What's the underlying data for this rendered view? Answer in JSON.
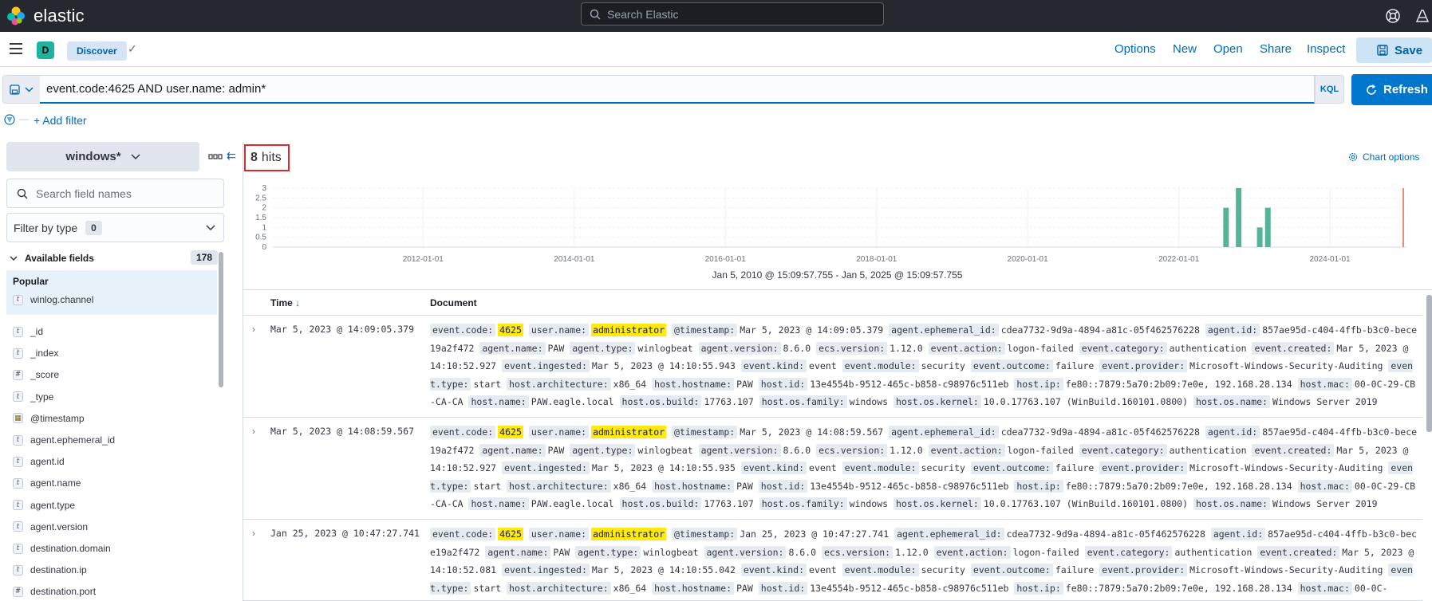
{
  "header": {
    "brand": "elastic",
    "search_placeholder": "Search Elastic"
  },
  "appbar": {
    "space_initial": "D",
    "breadcrumb": "Discover",
    "menu": [
      "Options",
      "New",
      "Open",
      "Share",
      "Inspect"
    ],
    "save_label": "Save"
  },
  "query": {
    "value": "event.code:4625 AND user.name: admin*",
    "language": "KQL",
    "refresh_label": "Refresh",
    "add_filter_label": "+ Add filter"
  },
  "sidebar": {
    "index_pattern": "windows*",
    "search_placeholder": "Search field names",
    "filter_by_type_label": "Filter by type",
    "filter_by_type_count": "0",
    "available_fields_label": "Available fields",
    "available_fields_count": "178",
    "popular_label": "Popular",
    "popular_fields": [
      {
        "type": "t",
        "name": "winlog.channel"
      }
    ],
    "fields": [
      {
        "type": "t",
        "name": "_id"
      },
      {
        "type": "t",
        "name": "_index"
      },
      {
        "type": "#",
        "name": "_score"
      },
      {
        "type": "t",
        "name": "_type"
      },
      {
        "type": "date",
        "name": "@timestamp"
      },
      {
        "type": "t",
        "name": "agent.ephemeral_id"
      },
      {
        "type": "t",
        "name": "agent.id"
      },
      {
        "type": "t",
        "name": "agent.name"
      },
      {
        "type": "t",
        "name": "agent.type"
      },
      {
        "type": "t",
        "name": "agent.version"
      },
      {
        "type": "t",
        "name": "destination.domain"
      },
      {
        "type": "t",
        "name": "destination.ip"
      },
      {
        "type": "#",
        "name": "destination.port"
      }
    ]
  },
  "results": {
    "hits_count": "8",
    "hits_label": "hits",
    "chart_options_label": "Chart options",
    "time_range": "Jan 5, 2010 @ 15:09:57.755 - Jan 5, 2025 @ 15:09:57.755",
    "columns": [
      "Time",
      "Document"
    ]
  },
  "chart_data": {
    "type": "bar",
    "y_ticks": [
      "3",
      "2.5",
      "2",
      "1.5",
      "1",
      "0.5",
      "0"
    ],
    "ylim": [
      0,
      3
    ],
    "x_tick_labels": [
      "2012-01-01",
      "2014-01-01",
      "2016-01-01",
      "2018-01-01",
      "2020-01-01",
      "2022-01-01",
      "2024-01-01"
    ],
    "x_range": [
      "2010-01-05",
      "2025-01-05"
    ],
    "bars": [
      {
        "x": "2022-08-15",
        "value": 2
      },
      {
        "x": "2022-10-15",
        "value": 3
      },
      {
        "x": "2023-01-25",
        "value": 1
      },
      {
        "x": "2023-03-05",
        "value": 2
      }
    ],
    "bar_color": "#54b399",
    "now_marker_color": "#e7664c"
  },
  "rows": [
    {
      "time": "Mar 5, 2023 @ 14:09:05.379",
      "doc": [
        [
          "event.code:",
          "4625",
          true
        ],
        [
          "user.name:",
          "administrator",
          true
        ],
        [
          "@timestamp:",
          "Mar 5, 2023 @ 14:09:05.379",
          false
        ],
        [
          "agent.ephemeral_id:",
          "cdea7732-9d9a-4894-a81c-05f462576228",
          false
        ],
        [
          "agent.id:",
          "857ae95d-c404-4ffb-b3c0-bece19a2f472",
          false
        ],
        [
          "agent.name:",
          "PAW",
          false
        ],
        [
          "agent.type:",
          "winlogbeat",
          false
        ],
        [
          "agent.version:",
          "8.6.0",
          false
        ],
        [
          "ecs.version:",
          "1.12.0",
          false
        ],
        [
          "event.action:",
          "logon-failed",
          false
        ],
        [
          "event.category:",
          "authentication",
          false
        ],
        [
          "event.created:",
          "Mar 5, 2023 @ 14:10:52.927",
          false
        ],
        [
          "event.ingested:",
          "Mar 5, 2023 @ 14:10:55.943",
          false
        ],
        [
          "event.kind:",
          "event",
          false
        ],
        [
          "event.module:",
          "security",
          false
        ],
        [
          "event.outcome:",
          "failure",
          false
        ],
        [
          "event.provider:",
          "Microsoft-Windows-Security-Auditing",
          false
        ],
        [
          "event.type:",
          "start",
          false
        ],
        [
          "host.architecture:",
          "x86_64",
          false
        ],
        [
          "host.hostname:",
          "PAW",
          false
        ],
        [
          "host.id:",
          "13e4554b-9512-465c-b858-c98976c511eb",
          false
        ],
        [
          "host.ip:",
          "fe80::7879:5a70:2b09:7e0e, 192.168.28.134",
          false
        ],
        [
          "host.mac:",
          "00-0C-29-CB-CA-CA",
          false
        ],
        [
          "host.name:",
          "PAW.eagle.local",
          false
        ],
        [
          "host.os.build:",
          "17763.107",
          false
        ],
        [
          "host.os.family:",
          "windows",
          false
        ],
        [
          "host.os.kernel:",
          "10.0.17763.107 (WinBuild.160101.0800)",
          false
        ],
        [
          "host.os.name:",
          "Windows Server 2019",
          false
        ]
      ]
    },
    {
      "time": "Mar 5, 2023 @ 14:08:59.567",
      "doc": [
        [
          "event.code:",
          "4625",
          true
        ],
        [
          "user.name:",
          "administrator",
          true
        ],
        [
          "@timestamp:",
          "Mar 5, 2023 @ 14:08:59.567",
          false
        ],
        [
          "agent.ephemeral_id:",
          "cdea7732-9d9a-4894-a81c-05f462576228",
          false
        ],
        [
          "agent.id:",
          "857ae95d-c404-4ffb-b3c0-bece19a2f472",
          false
        ],
        [
          "agent.name:",
          "PAW",
          false
        ],
        [
          "agent.type:",
          "winlogbeat",
          false
        ],
        [
          "agent.version:",
          "8.6.0",
          false
        ],
        [
          "ecs.version:",
          "1.12.0",
          false
        ],
        [
          "event.action:",
          "logon-failed",
          false
        ],
        [
          "event.category:",
          "authentication",
          false
        ],
        [
          "event.created:",
          "Mar 5, 2023 @ 14:10:52.927",
          false
        ],
        [
          "event.ingested:",
          "Mar 5, 2023 @ 14:10:55.935",
          false
        ],
        [
          "event.kind:",
          "event",
          false
        ],
        [
          "event.module:",
          "security",
          false
        ],
        [
          "event.outcome:",
          "failure",
          false
        ],
        [
          "event.provider:",
          "Microsoft-Windows-Security-Auditing",
          false
        ],
        [
          "event.type:",
          "start",
          false
        ],
        [
          "host.architecture:",
          "x86_64",
          false
        ],
        [
          "host.hostname:",
          "PAW",
          false
        ],
        [
          "host.id:",
          "13e4554b-9512-465c-b858-c98976c511eb",
          false
        ],
        [
          "host.ip:",
          "fe80::7879:5a70:2b09:7e0e, 192.168.28.134",
          false
        ],
        [
          "host.mac:",
          "00-0C-29-CB-CA-CA",
          false
        ],
        [
          "host.name:",
          "PAW.eagle.local",
          false
        ],
        [
          "host.os.build:",
          "17763.107",
          false
        ],
        [
          "host.os.family:",
          "windows",
          false
        ],
        [
          "host.os.kernel:",
          "10.0.17763.107 (WinBuild.160101.0800)",
          false
        ],
        [
          "host.os.name:",
          "Windows Server 2019",
          false
        ]
      ]
    },
    {
      "time": "Jan 25, 2023 @ 10:47:27.741",
      "doc": [
        [
          "event.code:",
          "4625",
          true
        ],
        [
          "user.name:",
          "administrator",
          true
        ],
        [
          "@timestamp:",
          "Jan 25, 2023 @ 10:47:27.741",
          false
        ],
        [
          "agent.ephemeral_id:",
          "cdea7732-9d9a-4894-a81c-05f462576228",
          false
        ],
        [
          "agent.id:",
          "857ae95d-c404-4ffb-b3c0-bece19a2f472",
          false
        ],
        [
          "agent.name:",
          "PAW",
          false
        ],
        [
          "agent.type:",
          "winlogbeat",
          false
        ],
        [
          "agent.version:",
          "8.6.0",
          false
        ],
        [
          "ecs.version:",
          "1.12.0",
          false
        ],
        [
          "event.action:",
          "logon-failed",
          false
        ],
        [
          "event.category:",
          "authentication",
          false
        ],
        [
          "event.created:",
          "Mar 5, 2023 @ 14:10:52.081",
          false
        ],
        [
          "event.ingested:",
          "Mar 5, 2023 @ 14:10:55.042",
          false
        ],
        [
          "event.kind:",
          "event",
          false
        ],
        [
          "event.module:",
          "security",
          false
        ],
        [
          "event.outcome:",
          "failure",
          false
        ],
        [
          "event.provider:",
          "Microsoft-Windows-Security-Auditing",
          false
        ],
        [
          "event.type:",
          "start",
          false
        ],
        [
          "host.architecture:",
          "x86_64",
          false
        ],
        [
          "host.hostname:",
          "PAW",
          false
        ],
        [
          "host.id:",
          "13e4554b-9512-465c-b858-c98976c511eb",
          false
        ],
        [
          "host.ip:",
          "fe80::7879:5a70:2b09:7e0e, 192.168.28.134",
          false
        ],
        [
          "host.mac:",
          "00-0C-",
          false
        ]
      ]
    }
  ]
}
